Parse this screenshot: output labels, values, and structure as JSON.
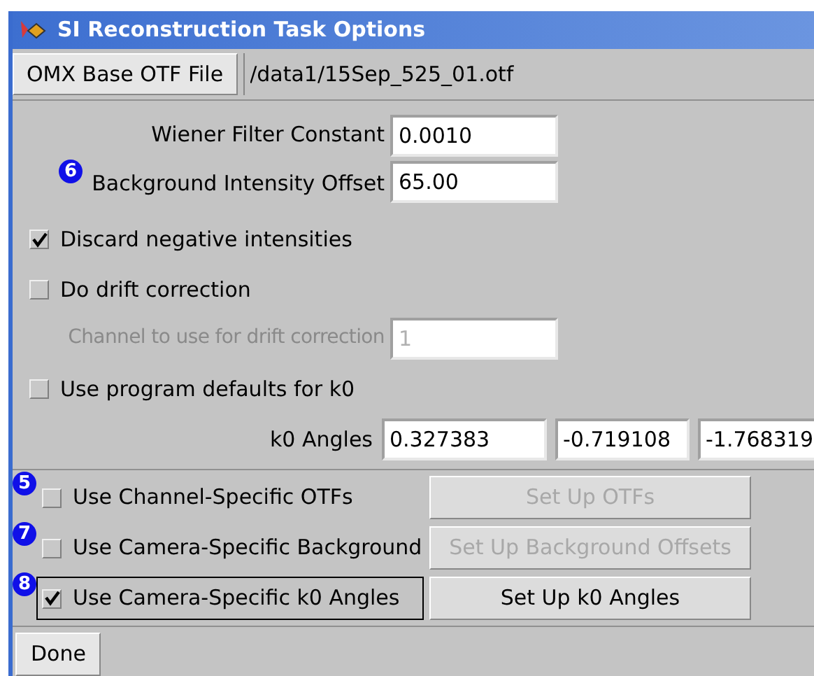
{
  "window": {
    "title": "SI Reconstruction Task Options"
  },
  "otf_file": {
    "button": "OMX Base OTF File",
    "value": "/data1/15Sep_525_01.otf"
  },
  "wiener": {
    "label": "Wiener Filter Constant",
    "value": "0.0010"
  },
  "background": {
    "label": "Background Intensity Offset",
    "value": "65.00",
    "callout": "6"
  },
  "discard": {
    "label": "Discard negative intensities",
    "checked": true
  },
  "drift": {
    "label": "Do drift correction",
    "checked": false
  },
  "drift_channel": {
    "label": "Channel to use for drift correction",
    "value": "1",
    "disabled": true
  },
  "k0_defaults": {
    "label": "Use program defaults for k0",
    "checked": false
  },
  "k0_angles": {
    "label": "k0 Angles",
    "values": [
      "0.327383",
      "-0.719108",
      "-1.768319"
    ]
  },
  "options": [
    {
      "label": "Use Channel-Specific OTFs",
      "checked": false,
      "focused": false,
      "callout": "5",
      "button": "Set Up OTFs",
      "button_disabled": true
    },
    {
      "label": "Use Camera-Specific Background",
      "checked": false,
      "focused": false,
      "callout": "7",
      "button": "Set Up Background Offsets",
      "button_disabled": true
    },
    {
      "label": "Use Camera-Specific k0 Angles",
      "checked": true,
      "focused": true,
      "callout": "8",
      "button": "Set Up k0 Angles",
      "button_disabled": false
    }
  ],
  "done_button": "Done"
}
